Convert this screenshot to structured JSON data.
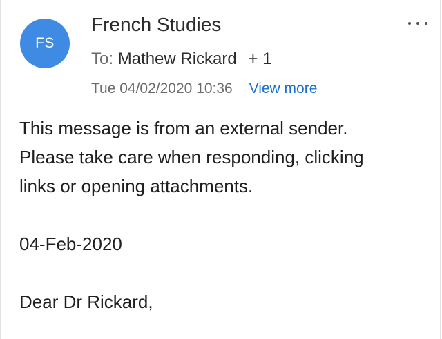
{
  "sender": {
    "initials": "FS",
    "name": "French Studies",
    "avatar_color": "#3f8be3"
  },
  "recipients": {
    "to_label": "To:",
    "name": "Mathew Rickard",
    "extra": "+ 1"
  },
  "meta": {
    "datetime": "Tue 04/02/2020 10:36",
    "view_more_label": "View more"
  },
  "menu": {
    "icon": "more-horizontal-icon"
  },
  "message": {
    "notice_lines": [
      "This message is from an external sender.",
      "Please take care when responding, clicking",
      "links or opening attachments."
    ],
    "date": "04-Feb-2020",
    "greeting": "Dear Dr Rickard,"
  },
  "colors": {
    "link": "#1a6fd1",
    "muted": "#6b6b6b"
  }
}
